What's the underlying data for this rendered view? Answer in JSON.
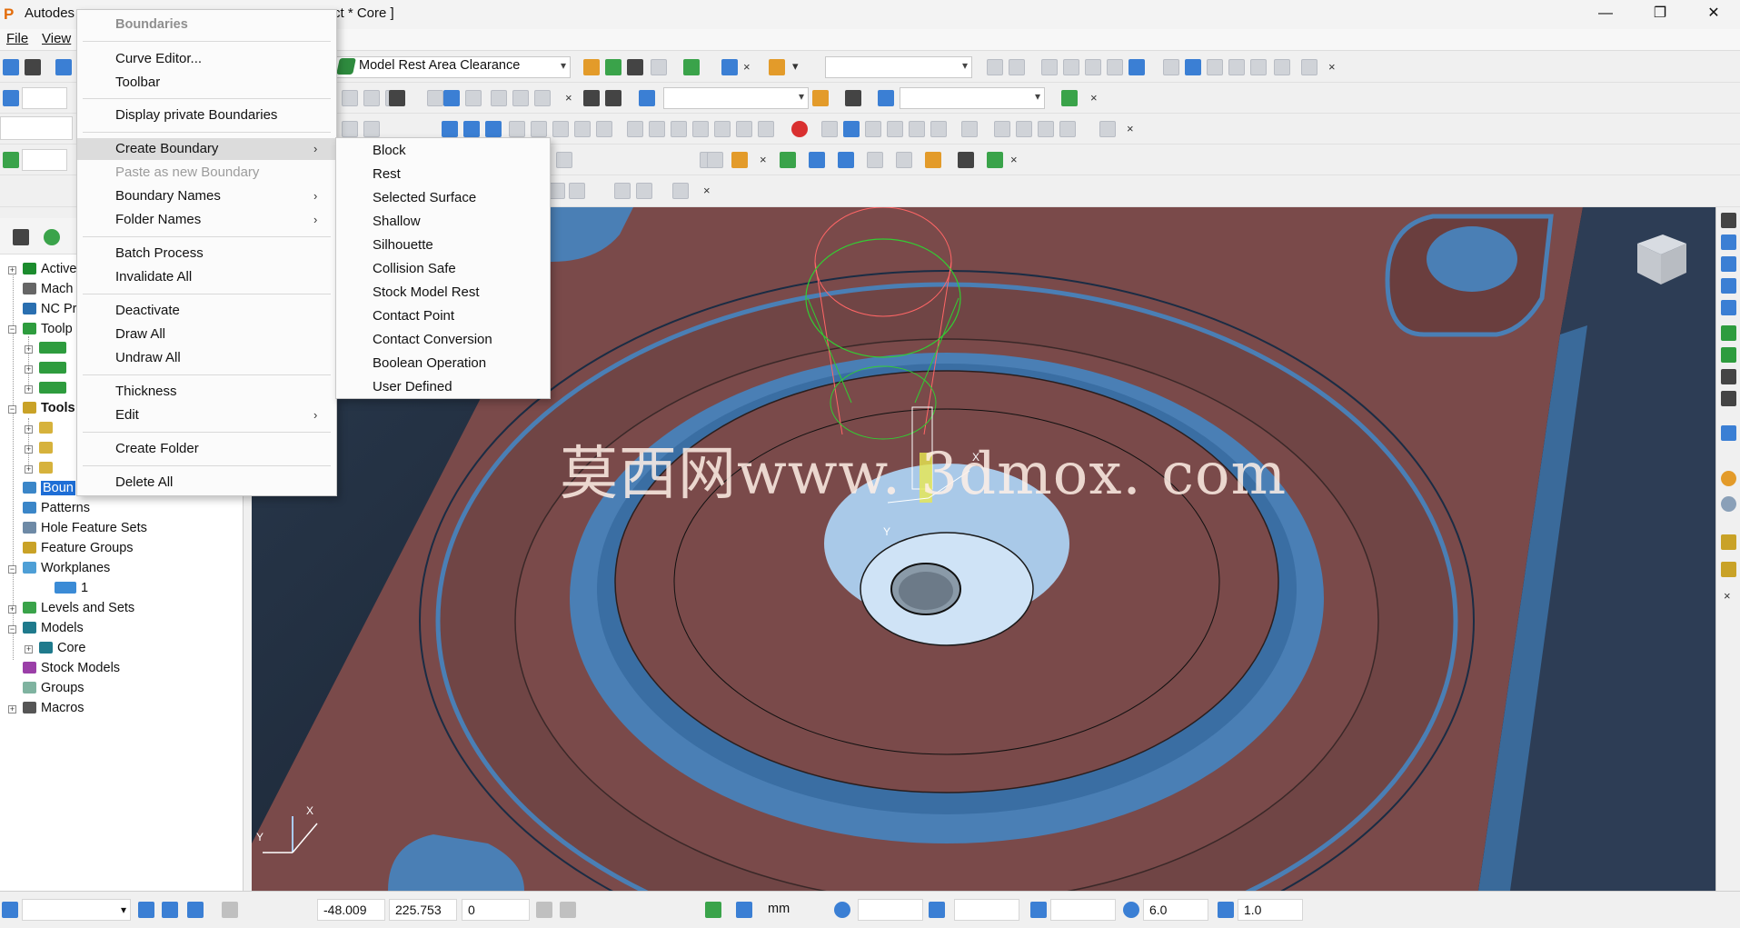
{
  "window": {
    "title_left": "Autodes",
    "title_right": "ct * Core ]",
    "minimize_glyph": "—",
    "maximize_glyph": "❐",
    "close_glyph": "✕"
  },
  "menubar": {
    "file": "File",
    "view": "View"
  },
  "toolbar": {
    "strategy_selector": "Model Rest Area Clearance",
    "close_glyph": "×"
  },
  "explorer": {
    "items": [
      "Active",
      "Mach",
      "NC Pr",
      "Toolp",
      "Tools",
      "Boun",
      "Patterns",
      "Hole Feature Sets",
      "Feature Groups",
      "Workplanes",
      "1",
      "Levels and Sets",
      "Models",
      "Core",
      "Stock Models",
      "Groups",
      "Macros"
    ]
  },
  "context_menu": {
    "title": "Boundaries",
    "items": [
      "Curve Editor...",
      "Toolbar",
      "Display private Boundaries",
      "Create Boundary",
      "Paste as new Boundary",
      "Boundary Names",
      "Folder Names",
      "Batch Process",
      "Invalidate All",
      "Deactivate",
      "Draw All",
      "Undraw All",
      "Thickness",
      "Edit",
      "Create Folder",
      "Delete All"
    ],
    "submenu_arrow": "›"
  },
  "submenu": {
    "items": [
      "Block",
      "Rest",
      "Selected Surface",
      "Shallow",
      "Silhouette",
      "Collision Safe",
      "Stock Model Rest",
      "Contact Point",
      "Contact Conversion",
      "Boolean Operation",
      "User Defined"
    ]
  },
  "viewport": {
    "watermark": "莫西网www. 3dmox. com",
    "triad_x": "X",
    "triad_y": "Y",
    "tool_x": "X",
    "tool_y": "Y"
  },
  "statusbar": {
    "x_coord": "-48.009",
    "y_coord": "225.753",
    "z_coord": "0",
    "units": "mm",
    "tool_diameter": "6.0",
    "tolerance": "1.0"
  },
  "colors": {
    "model_surface": "#7a4a4a",
    "pocket_blue": "#4a7fb5",
    "selection": "#1e6ed6"
  }
}
